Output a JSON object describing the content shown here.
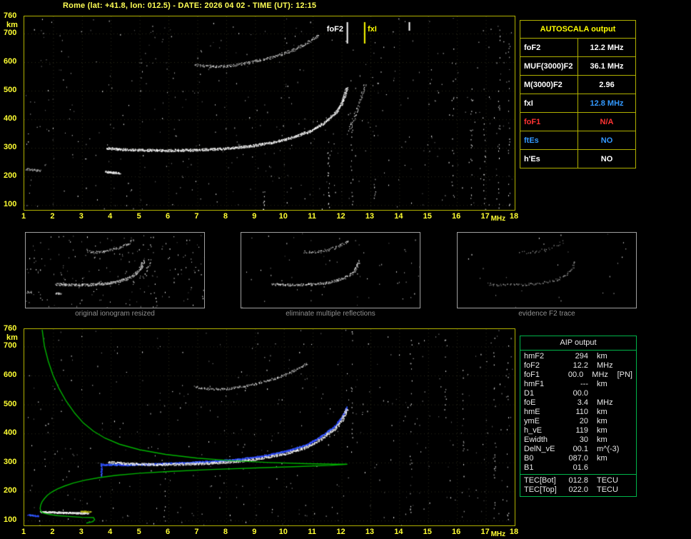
{
  "title": "Rome (lat: +41.8, lon: 012.5) - DATE: 2026 04 02 - TIME (UT): 12:15",
  "colors": {
    "background": "#000000",
    "title": "#ffff55",
    "axis_label": "#ffff33",
    "plot_border": "#b0b000",
    "autoscala_border": "#b0b000",
    "aip_border": "#00b44a",
    "caption": "#909090",
    "green_profile": "#00b400",
    "palettes": {
      "bright": [
        "#ffffff",
        "#e8e8e8",
        "#d0d0d0"
      ],
      "mid": [
        "#e0e0e0",
        "#b0b0b0",
        "#909090"
      ],
      "dim": [
        "#a0a0a0",
        "#787878",
        "#585858"
      ],
      "blue": [
        "#2e3cff",
        "#2255ee",
        "#4466ff"
      ],
      "yellow": [
        "#cccc33",
        "#b0b000"
      ],
      "noise": [
        "#ffffff",
        "#c0c0c0",
        "#8a8a8a",
        "#5a5a5a"
      ]
    }
  },
  "axes": {
    "y_labels": [
      "760",
      "700",
      "600",
      "500",
      "400",
      "300",
      "200",
      "100"
    ],
    "y_unit": "km",
    "x_labels": [
      "1",
      "2",
      "3",
      "4",
      "5",
      "6",
      "7",
      "8",
      "9",
      "10",
      "11",
      "12",
      "13",
      "14",
      "15",
      "16",
      "17",
      "18"
    ],
    "x_unit": "MHz"
  },
  "autoscala_table": {
    "title": "AUTOSCALA output",
    "rows": [
      {
        "label": "foF2",
        "value": "12.2 MHz",
        "label_color": "#ffffff",
        "value_color": "#ffffff"
      },
      {
        "label": "MUF(3000)F2",
        "value": "36.1 MHz",
        "label_color": "#ffffff",
        "value_color": "#ffffff"
      },
      {
        "label": "M(3000)F2",
        "value": "2.96",
        "label_color": "#ffffff",
        "value_color": "#ffffff"
      },
      {
        "label": "fxI",
        "value": "12.8 MHz",
        "label_color": "#ffffff",
        "value_color": "#3399ff"
      },
      {
        "label": "foF1",
        "value": "N/A",
        "label_color": "#ff3333",
        "value_color": "#ff3333"
      },
      {
        "label": "ftEs",
        "value": "NO",
        "label_color": "#3399ff",
        "value_color": "#3399ff"
      },
      {
        "label": "h'Es",
        "value": "NO",
        "label_color": "#ffffff",
        "value_color": "#ffffff"
      }
    ]
  },
  "aip_table": {
    "title": "AIP output",
    "rows": [
      {
        "name": "hmF2",
        "value": "294",
        "unit": "km",
        "extra": ""
      },
      {
        "name": "foF2",
        "value": "12.2",
        "unit": "MHz",
        "extra": ""
      },
      {
        "name": "foF1",
        "value": "00.0",
        "unit": "MHz",
        "extra": "[PN]"
      },
      {
        "name": "hmF1",
        "value": "---",
        "unit": "km",
        "extra": ""
      },
      {
        "name": "D1",
        "value": "00.0",
        "unit": "",
        "extra": ""
      },
      {
        "name": "foE",
        "value": "3.4",
        "unit": "MHz",
        "extra": ""
      },
      {
        "name": "hmE",
        "value": "110",
        "unit": "km",
        "extra": ""
      },
      {
        "name": "ymE",
        "value": "20",
        "unit": "km",
        "extra": ""
      },
      {
        "name": "h_vE",
        "value": "119",
        "unit": "km",
        "extra": ""
      },
      {
        "name": "Ewidth",
        "value": "30",
        "unit": "km",
        "extra": ""
      },
      {
        "name": "DelN_vE",
        "value": "00.1",
        "unit": "m^(-3)",
        "extra": ""
      },
      {
        "name": "B0",
        "value": "087.0",
        "unit": "km",
        "extra": ""
      },
      {
        "name": "B1",
        "value": "01.6",
        "unit": "",
        "extra": ""
      }
    ],
    "tec_rows": [
      {
        "name": "TEC[Bot]",
        "value": "012.8",
        "unit": "TECU",
        "extra": ""
      },
      {
        "name": "TEC[Top]",
        "value": "022.0",
        "unit": "TECU",
        "extra": ""
      }
    ]
  },
  "panels": [
    {
      "caption": "original ionogram resized"
    },
    {
      "caption": "eliminate multiple reflections"
    },
    {
      "caption": "evidence F2 trace"
    }
  ],
  "chart_data": {
    "type": "scatter",
    "x_range_mhz": [
      1,
      18
    ],
    "y_range_km": [
      83,
      760
    ],
    "xlabel": "MHz",
    "ylabel": "km",
    "top_plot": {
      "markers": [
        {
          "label": "foF2",
          "x": 12.2,
          "color": "#ffffff",
          "short": false
        },
        {
          "label": "fxI",
          "x": 12.8,
          "color": "#ffff00",
          "short": false
        },
        {
          "label": "",
          "x": 14.35,
          "color": "#ffffff",
          "short": true
        }
      ],
      "traces": [
        {
          "name": "f2-trace",
          "palette": "bright",
          "density": 2.3,
          "jitter": 1.6,
          "size": 1.4,
          "points": [
            [
              3.85,
              300
            ],
            [
              4.3,
              296
            ],
            [
              5,
              293
            ],
            [
              6,
              292
            ],
            [
              7,
              294
            ],
            [
              8,
              299
            ],
            [
              8.8,
              307
            ],
            [
              9.6,
              320
            ],
            [
              10.3,
              338
            ],
            [
              10.9,
              360
            ],
            [
              11.4,
              390
            ],
            [
              11.8,
              425
            ],
            [
              12.0,
              458
            ],
            [
              12.1,
              488
            ],
            [
              12.18,
              512
            ]
          ]
        },
        {
          "name": "fxi-branch",
          "palette": "mid",
          "density": 0.8,
          "jitter": 2.0,
          "size": 1.3,
          "points": [
            [
              12.24,
              365
            ],
            [
              12.42,
              405
            ],
            [
              12.58,
              450
            ],
            [
              12.72,
              495
            ],
            [
              12.8,
              528
            ]
          ]
        },
        {
          "name": "second-hop-echo",
          "palette": "mid",
          "density": 1.4,
          "jitter": 1.8,
          "size": 1.3,
          "points": [
            [
              6.9,
              592
            ],
            [
              7.6,
              585
            ],
            [
              8.2,
              589
            ],
            [
              8.8,
              600
            ],
            [
              9.4,
              614
            ],
            [
              10.0,
              632
            ],
            [
              10.5,
              652
            ],
            [
              10.9,
              674
            ],
            [
              11.2,
              696
            ]
          ]
        },
        {
          "name": "left-fragment",
          "palette": "mid",
          "density": 1.5,
          "jitter": 1.5,
          "size": 1.3,
          "points": [
            [
              1.05,
              228
            ],
            [
              1.55,
              221
            ]
          ]
        },
        {
          "name": "es-fragment",
          "palette": "bright",
          "density": 2.6,
          "jitter": 1.2,
          "size": 1.5,
          "points": [
            [
              3.8,
              218
            ],
            [
              4.3,
              212
            ]
          ]
        }
      ],
      "noise": {
        "count": 420,
        "streaks": [
          {
            "x": 11.55,
            "km": [
              90,
              340
            ],
            "count": 22
          },
          {
            "x": 12.35,
            "km": [
              100,
              390
            ],
            "count": 16
          },
          {
            "x": 9.3,
            "km": [
              85,
              150
            ],
            "count": 10
          },
          {
            "x": 13.15,
            "km": [
              90,
              200
            ],
            "count": 8
          },
          {
            "x": 15.85,
            "km": [
              90,
              700
            ],
            "count": 16
          },
          {
            "x": 16.5,
            "km": [
              90,
              520
            ],
            "count": 20
          },
          {
            "x": 16.95,
            "km": [
              120,
              430
            ],
            "count": 14
          },
          {
            "x": 17.45,
            "km": [
              90,
              740
            ],
            "count": 24
          },
          {
            "x": 17.8,
            "km": [
              90,
              740
            ],
            "count": 18
          }
        ]
      }
    },
    "bottom_plot": {
      "traces": [
        {
          "name": "second-hop-echo",
          "palette": "mid",
          "density": 1.2,
          "jitter": 1.6,
          "size": 1.3,
          "points": [
            [
              6.9,
              562
            ],
            [
              7.5,
              553
            ],
            [
              8.1,
              556
            ],
            [
              8.7,
              566
            ],
            [
              9.3,
              580
            ],
            [
              9.9,
              598
            ],
            [
              10.4,
              620
            ],
            [
              10.8,
              642
            ]
          ]
        },
        {
          "name": "blue-vertical-segment",
          "palette": "blue",
          "density": 1.6,
          "jitter": 0.8,
          "size": 1.5,
          "points": [
            [
              3.66,
              252
            ],
            [
              3.66,
              300
            ]
          ]
        },
        {
          "name": "blue-restored-trace",
          "palette": "blue",
          "density": 2.4,
          "jitter": 1.0,
          "size": 1.6,
          "points": [
            [
              3.7,
              294
            ],
            [
              4.6,
              293
            ],
            [
              5.5,
              296
            ],
            [
              6.5,
              300
            ],
            [
              7.5,
              305
            ],
            [
              8.5,
              313
            ],
            [
              9.3,
              324
            ],
            [
              10.1,
              341
            ],
            [
              10.8,
              363
            ],
            [
              11.3,
              392
            ],
            [
              11.8,
              430
            ],
            [
              12.0,
              458
            ],
            [
              12.1,
              475
            ],
            [
              12.18,
              492
            ]
          ]
        },
        {
          "name": "f2-trace",
          "palette": "bright",
          "density": 2.0,
          "jitter": 1.6,
          "size": 1.4,
          "points": [
            [
              3.9,
              302
            ],
            [
              4.6,
              297
            ],
            [
              5.5,
              294
            ],
            [
              6.5,
              295
            ],
            [
              7.5,
              299
            ],
            [
              8.5,
              306
            ],
            [
              9.3,
              317
            ],
            [
              10.1,
              333
            ],
            [
              10.8,
              355
            ],
            [
              11.3,
              383
            ],
            [
              11.8,
              420
            ],
            [
              12.0,
              448
            ],
            [
              12.1,
              468
            ],
            [
              12.18,
              486
            ]
          ]
        },
        {
          "name": "e-trace",
          "palette": "bright",
          "density": 3.0,
          "jitter": 1.0,
          "size": 1.5,
          "points": [
            [
              1.55,
              131
            ],
            [
              2.4,
              128
            ],
            [
              3.2,
              126
            ]
          ]
        },
        {
          "name": "e-trace-yellow",
          "palette": "yellow",
          "density": 2.5,
          "jitter": 1.0,
          "size": 1.4,
          "points": [
            [
              2.95,
              133
            ],
            [
              3.3,
              131
            ]
          ]
        },
        {
          "name": "e-trace-blue",
          "palette": "blue",
          "density": 2.2,
          "jitter": 1.0,
          "size": 1.5,
          "points": [
            [
              1.12,
              120
            ],
            [
              1.5,
              117
            ]
          ]
        }
      ],
      "green_profile": [
        [
          1.62,
          758
        ],
        [
          1.7,
          700
        ],
        [
          1.83,
          650
        ],
        [
          2.0,
          600
        ],
        [
          2.2,
          556
        ],
        [
          2.45,
          512
        ],
        [
          2.75,
          470
        ],
        [
          3.05,
          436
        ],
        [
          3.4,
          408
        ],
        [
          3.8,
          384
        ],
        [
          4.3,
          363
        ],
        [
          5.0,
          344
        ],
        [
          5.9,
          328
        ],
        [
          7.0,
          315
        ],
        [
          8.2,
          306
        ],
        [
          9.5,
          300
        ],
        [
          10.8,
          296
        ],
        [
          11.8,
          294
        ],
        [
          12.2,
          294
        ],
        [
          11.6,
          290
        ],
        [
          10.5,
          286
        ],
        [
          9.0,
          281
        ],
        [
          7.5,
          276
        ],
        [
          6.0,
          269
        ],
        [
          5.0,
          263
        ],
        [
          4.2,
          256
        ],
        [
          3.6,
          248
        ],
        [
          3.1,
          239
        ],
        [
          2.7,
          229
        ],
        [
          2.4,
          219
        ],
        [
          2.15,
          209
        ],
        [
          1.95,
          198
        ],
        [
          1.8,
          187
        ],
        [
          1.7,
          176
        ],
        [
          1.62,
          165
        ],
        [
          1.57,
          153
        ],
        [
          1.55,
          142
        ],
        [
          1.57,
          133
        ],
        [
          1.65,
          126
        ],
        [
          1.85,
          121
        ],
        [
          2.15,
          117
        ],
        [
          2.55,
          114
        ],
        [
          3.0,
          111
        ],
        [
          3.4,
          110
        ],
        [
          3.44,
          103
        ],
        [
          3.38,
          96
        ],
        [
          3.15,
          91
        ]
      ],
      "noise": {
        "count": 380,
        "streaks": [
          {
            "x": 5.85,
            "km": [
              90,
              310
            ],
            "count": 12
          },
          {
            "x": 12.35,
            "km": [
              330,
              760
            ],
            "count": 16
          },
          {
            "x": 14.4,
            "km": [
              90,
              740
            ],
            "count": 20
          },
          {
            "x": 15.6,
            "km": [
              400,
              740
            ],
            "count": 12
          },
          {
            "x": 16.2,
            "km": [
              90,
              620
            ],
            "count": 14
          },
          {
            "x": 17.3,
            "km": [
              90,
              740
            ],
            "count": 22
          },
          {
            "x": 17.75,
            "km": [
              90,
              740
            ],
            "count": 16
          }
        ]
      }
    },
    "panels_render": [
      {
        "include": [
          0,
          1,
          2,
          3,
          4
        ],
        "noise": 200,
        "density_scale": 0.8,
        "palette": "mid"
      },
      {
        "include": [
          0,
          2
        ],
        "noise": 60,
        "density_scale": 0.6,
        "palette": "mid"
      },
      {
        "include": [
          0,
          2
        ],
        "noise": 26,
        "density_scale": 0.3,
        "palette": "dim"
      }
    ]
  }
}
